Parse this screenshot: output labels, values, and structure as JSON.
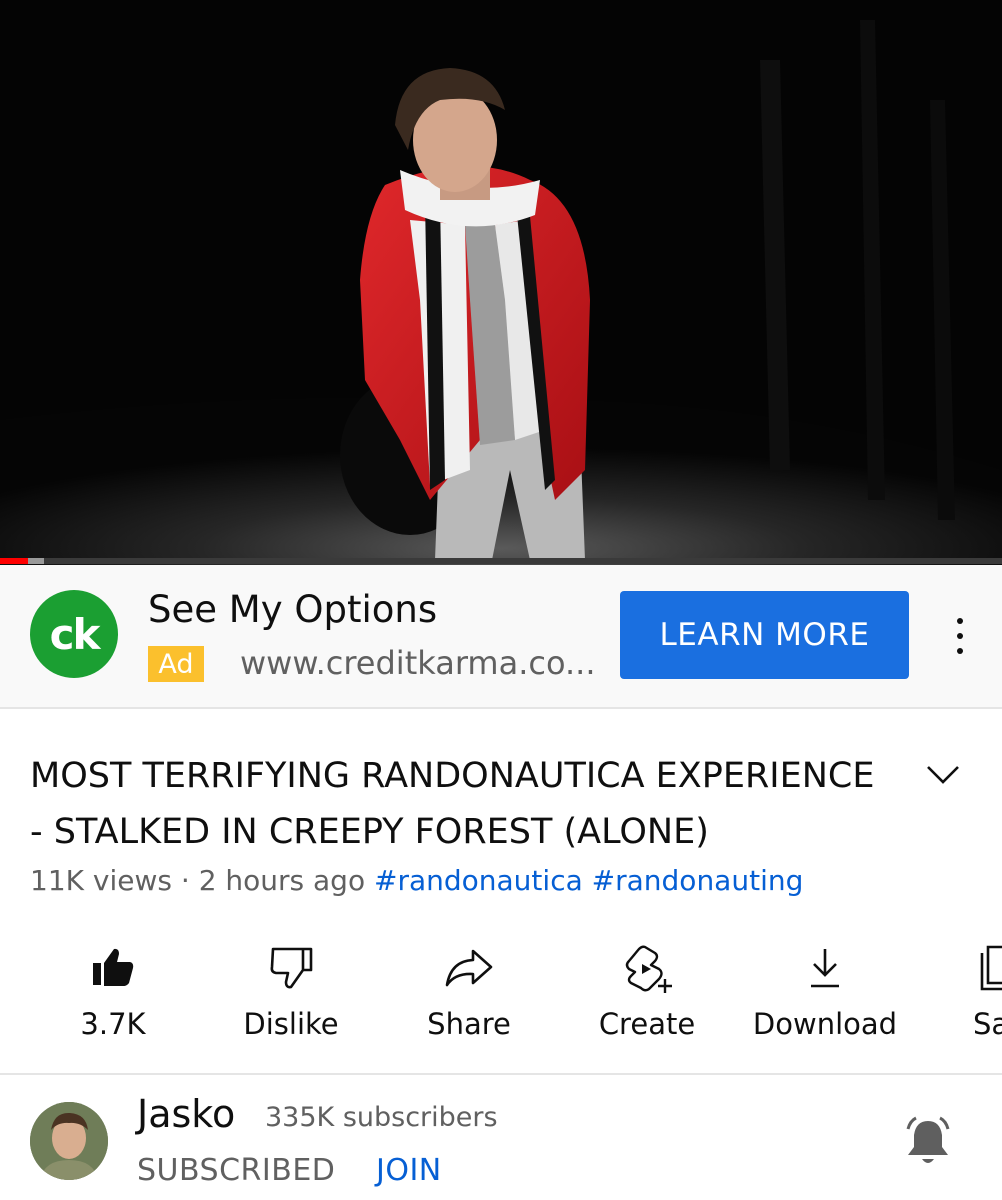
{
  "player": {
    "progress_played": 0.028,
    "progress_buffered": 0.044
  },
  "ad": {
    "logo_text": "ck",
    "title": "See My Options",
    "badge": "Ad",
    "url": "www.creditkarma.co...",
    "cta": "LEARN MORE",
    "colors": {
      "logo_bg": "#1b9f32",
      "badge_bg": "#fbc02d",
      "cta_bg": "#1a6fe0"
    }
  },
  "video": {
    "title_line1": "MOST TERRIFYING RANDONAUTICA EXPERIENCE",
    "title_line2": "- STALKED IN CREEPY FOREST (ALONE)",
    "views": "11K views",
    "separator": "·",
    "age": "2 hours ago",
    "hashtags": [
      "#randonautica",
      "#randonauting"
    ]
  },
  "actions": [
    {
      "icon": "thumbs-up-filled-icon",
      "label": "3.7K"
    },
    {
      "icon": "thumbs-down-icon",
      "label": "Dislike"
    },
    {
      "icon": "share-icon",
      "label": "Share"
    },
    {
      "icon": "create-icon",
      "label": "Create"
    },
    {
      "icon": "download-icon",
      "label": "Download"
    },
    {
      "icon": "save-playlist-icon",
      "label": "Sa"
    }
  ],
  "channel": {
    "name": "Jasko",
    "subscribers": "335K subscribers",
    "subscribed_label": "SUBSCRIBED",
    "join_label": "JOIN",
    "bell_icon": "notification-bell-icon"
  },
  "colors": {
    "link": "#065fd4",
    "secondary_text": "#606060",
    "progress": "#ff0000"
  }
}
